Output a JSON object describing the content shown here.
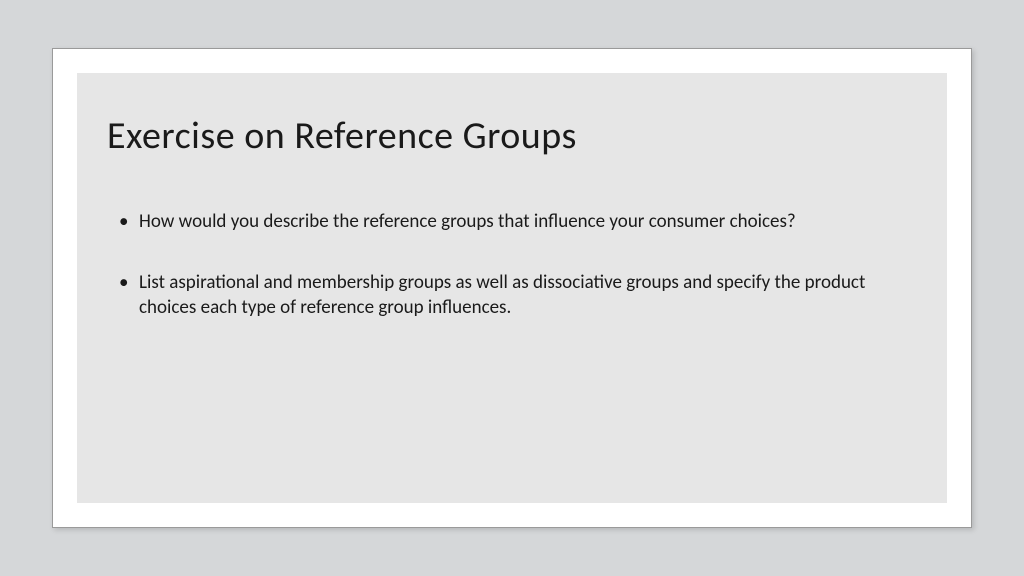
{
  "slide": {
    "title": "Exercise on  Reference Groups",
    "bullets": [
      "How would you describe the reference groups that influence your consumer choices?",
      " List aspirational and membership groups as well as dissociative groups and specify the product choices each type of reference group influences."
    ]
  }
}
